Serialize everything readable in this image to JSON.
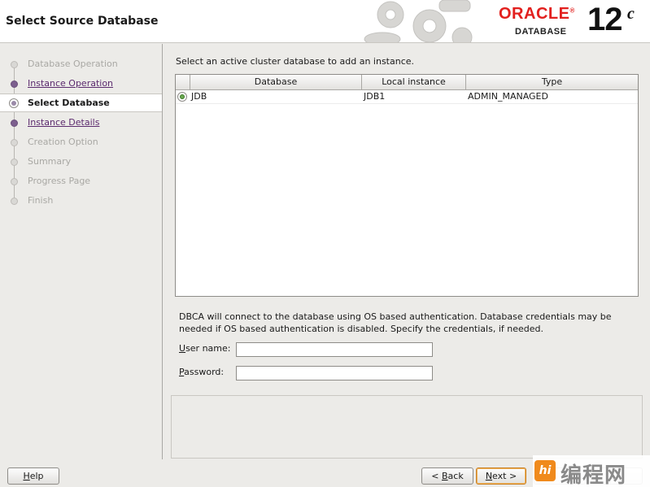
{
  "header": {
    "title": "Select Source Database",
    "logo_oracle": "ORACLE",
    "logo_reg": "®",
    "logo_database": "DATABASE",
    "logo_version": "12",
    "logo_suffix": "c"
  },
  "sidebar": {
    "steps": [
      {
        "label": "Database Operation",
        "state": "disabled"
      },
      {
        "label": "Instance Operation",
        "state": "done"
      },
      {
        "label": "Select Database",
        "state": "active"
      },
      {
        "label": "Instance Details",
        "state": "done"
      },
      {
        "label": "Creation Option",
        "state": "disabled"
      },
      {
        "label": "Summary",
        "state": "disabled"
      },
      {
        "label": "Progress Page",
        "state": "disabled"
      },
      {
        "label": "Finish",
        "state": "disabled"
      }
    ]
  },
  "main": {
    "instruction": "Select an active cluster database to add an instance.",
    "table": {
      "columns": [
        "Database",
        "Local instance",
        "Type"
      ],
      "rows": [
        {
          "selected": true,
          "database": "JDB",
          "local_instance": "JDB1",
          "type": "ADMIN_MANAGED"
        }
      ]
    },
    "auth_note": "DBCA will connect to the database using OS based authentication. Database credentials may be needed if OS based authentication is disabled. Specify the credentials, if needed.",
    "username_label_mnemonic": "U",
    "username_label_rest": "ser name:",
    "username_value": "",
    "password_label_mnemonic": "P",
    "password_label_rest": "assword:",
    "password_value": ""
  },
  "footer": {
    "help": {
      "mnemonic": "H",
      "rest": "elp"
    },
    "back": {
      "prefix": "< ",
      "mnemonic": "B",
      "rest": "ack"
    },
    "next": {
      "mnemonic": "N",
      "rest": "ext >"
    }
  },
  "watermark": {
    "badge": "hi",
    "text": "编程网"
  },
  "colors": {
    "accent_purple": "#5b2a6e",
    "oracle_red": "#e2201e",
    "focus_orange": "#c87f23"
  }
}
